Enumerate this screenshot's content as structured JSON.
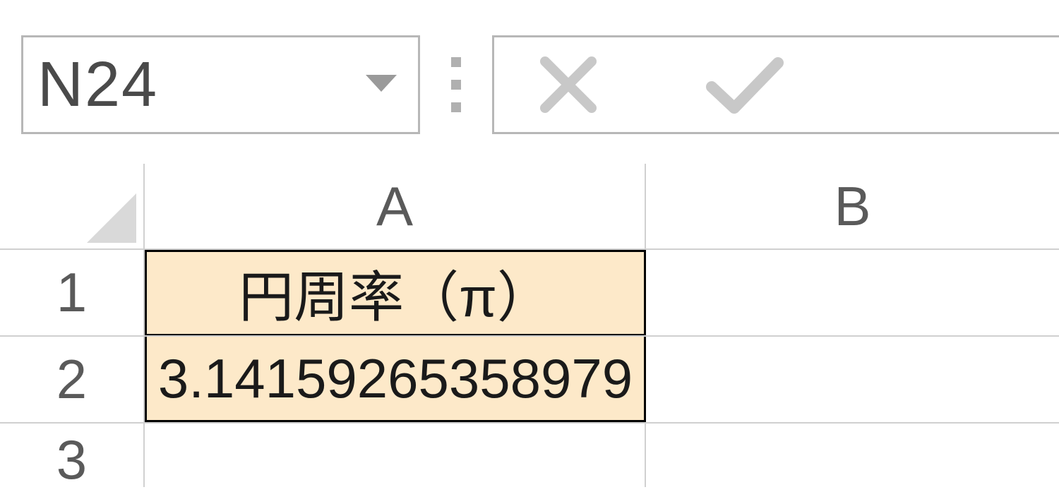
{
  "name_box": {
    "value": "N24"
  },
  "columns": {
    "A": "A",
    "B": "B"
  },
  "rows": {
    "r1": "1",
    "r2": "2",
    "r3": "3"
  },
  "cells": {
    "A1": "円周率（π）",
    "A2": "3.14159265358979"
  },
  "colors": {
    "highlight_fill": "#fde9c9",
    "grid_line": "#d0d0d0"
  }
}
